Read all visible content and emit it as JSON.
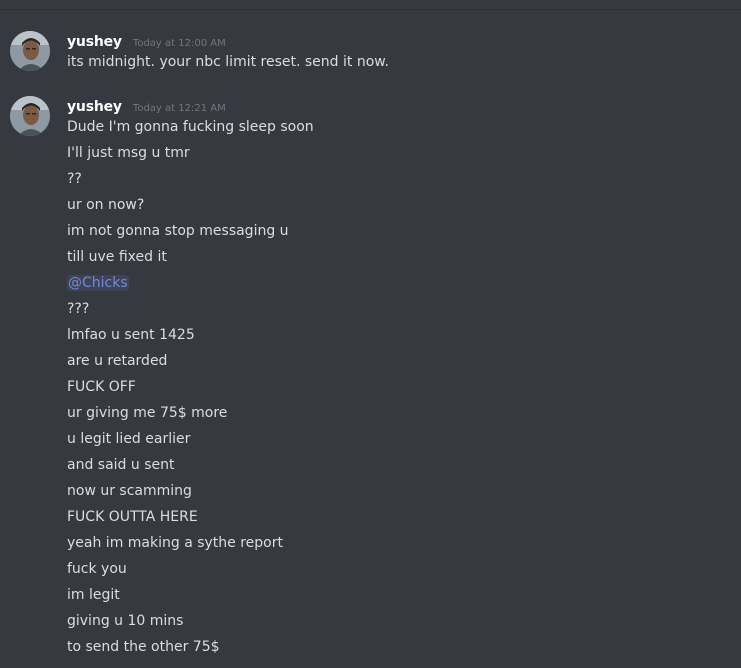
{
  "messages": [
    {
      "username": "yushey",
      "timestamp": "Today at 12:00 AM",
      "lines": [
        "its midnight. your nbc limit reset. send it now."
      ]
    },
    {
      "username": "yushey",
      "timestamp": "Today at 12:21 AM",
      "lines": [
        "Dude I'm gonna fucking sleep soon",
        "I'll just msg u tmr",
        "??",
        "ur on now?",
        "im not gonna stop messaging u",
        "till uve fixed it",
        "@Chicks",
        "???",
        "lmfao u sent 1425",
        "are u retarded",
        "FUCK OFF",
        "ur giving me 75$ more",
        "u legit lied earlier",
        "and said u sent",
        "now ur scamming",
        "FUCK OUTTA HERE",
        "yeah im making a sythe report",
        "fuck you",
        "im legit",
        "giving u 10 mins",
        "to send the other 75$"
      ]
    }
  ],
  "avatar_icon": "user-avatar-photo",
  "colors": {
    "background": "#36393f",
    "username": "#ffffff",
    "timestamp": "#72767d",
    "text": "#dcddde",
    "mention": "#7289da"
  }
}
